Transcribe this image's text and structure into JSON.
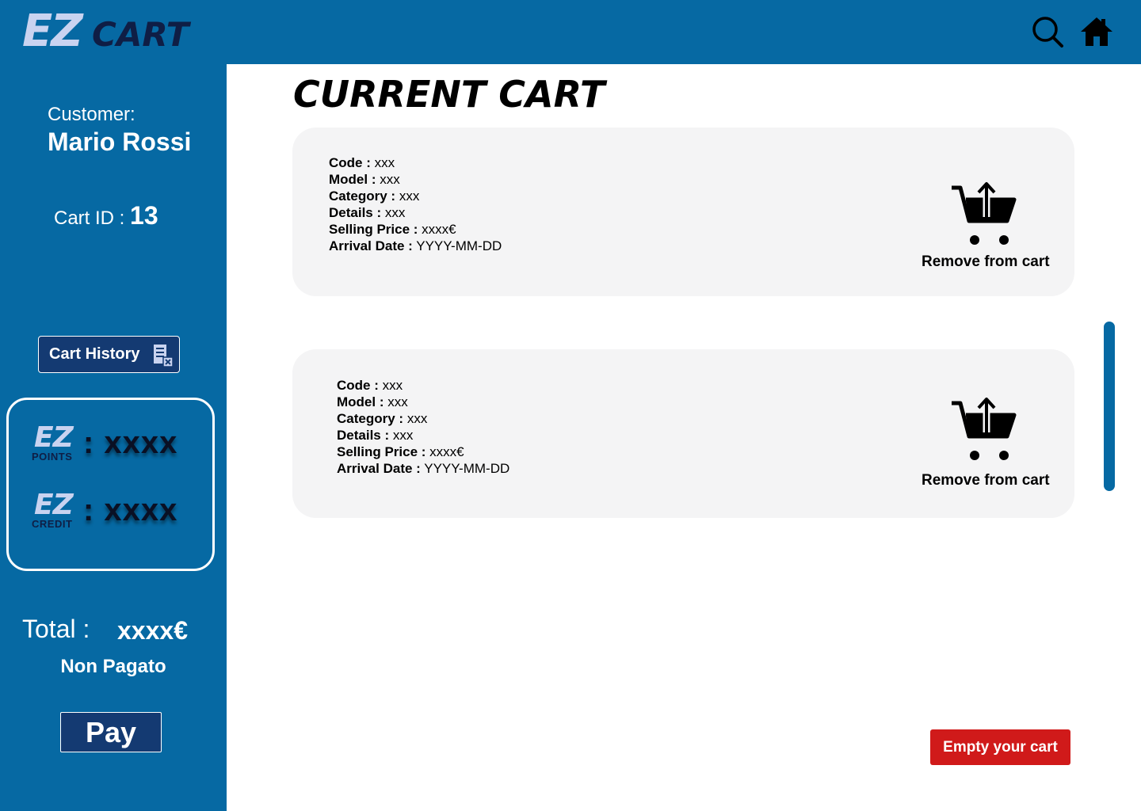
{
  "header": {
    "logo_ez": "EZ",
    "logo_cart": "CART",
    "icons": [
      "search-icon",
      "home-icon"
    ]
  },
  "sidebar": {
    "customer_label": "Customer:",
    "customer_name": "Mario Rossi",
    "cart_id_label": "Cart ID : ",
    "cart_id_value": "13",
    "history_button": "Cart History",
    "ez_points_logo": "EZ",
    "ez_points_sub": "POINTS",
    "ez_points_value": ": xxxx",
    "ez_credit_logo": "EZ",
    "ez_credit_sub": "CREDIT",
    "ez_credit_value": ": xxxx",
    "total_label": "Total :",
    "total_value": "xxxx€",
    "payment_status": "Non Pagato",
    "pay_button": "Pay"
  },
  "main": {
    "title": "CURRENT CART",
    "items": [
      {
        "code_label": "Code :",
        "code": "xxx",
        "model_label": "Model :",
        "model": "xxx",
        "category_label": "Category :",
        "category": "xxx",
        "details_label": "Details :",
        "details": "xxx",
        "price_label": "Selling Price :",
        "price": "xxxx€",
        "arrival_label": "Arrival Date :",
        "arrival": "YYYY-MM-DD",
        "remove_label": "Remove from cart"
      },
      {
        "code_label": "Code :",
        "code": "xxx",
        "model_label": "Model :",
        "model": "xxx",
        "category_label": "Category :",
        "category": "xxx",
        "details_label": "Details :",
        "details": "xxx",
        "price_label": "Selling Price :",
        "price": "xxxx€",
        "arrival_label": "Arrival Date :",
        "arrival": "YYYY-MM-DD",
        "remove_label": "Remove from cart"
      }
    ],
    "empty_button": "Empty your cart"
  },
  "colors": {
    "primary_blue": "#0669a3",
    "navy": "#143a72",
    "danger_red": "#d01a1a",
    "card_bg": "#f4f4f5"
  }
}
